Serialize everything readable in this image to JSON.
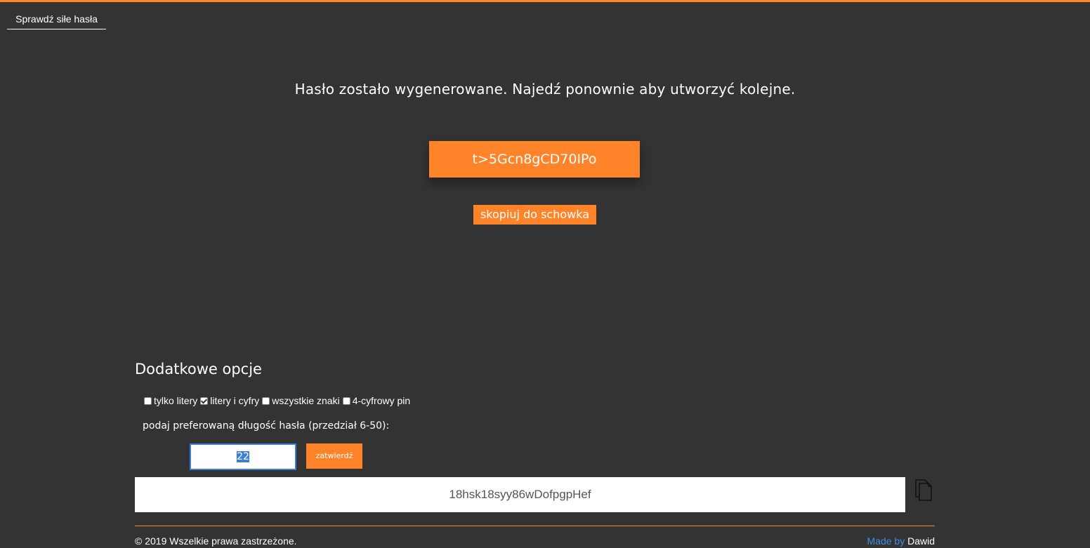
{
  "nav": {
    "check_strength_label": "Sprawdź siłe hasła"
  },
  "main": {
    "message": "Hasło zostało wygenerowane. Najedź ponownie aby utworzyć kolejne.",
    "password": "t>5Gcn8gCD70IPo",
    "copy_button": "skopiuj do schowka"
  },
  "options": {
    "title": "Dodatkowe opcje",
    "checkboxes": [
      {
        "label": "tylko litery",
        "checked": false
      },
      {
        "label": "litery i cyfry",
        "checked": true
      },
      {
        "label": "wszystkie znaki",
        "checked": false
      },
      {
        "label": "4-cyfrowy pin",
        "checked": false
      }
    ],
    "length_label": "podaj preferowaną długość hasła (przedział 6-50):",
    "length_value": "22",
    "confirm_button": "zatwierdź",
    "result_password": "18hsk18syy86wDofpgpHef",
    "copy_icon": "clipboard-icon"
  },
  "footer": {
    "copyright": "© 2019 Wszelkie prawa zastrzeżone.",
    "made_by": "Made by",
    "author": "Dawid"
  },
  "colors": {
    "accent": "#ff8329",
    "background": "#333333",
    "link": "#3d8fe0"
  }
}
